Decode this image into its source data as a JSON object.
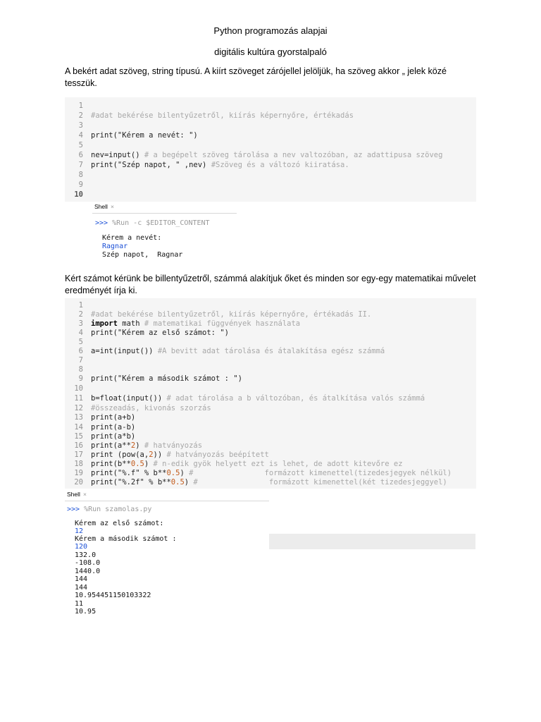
{
  "heading": {
    "title": "Python programozás alapjai",
    "subtitle": "digitális kultúra gyorstalpaló"
  },
  "intro_paragraph": "A bekért adat szöveg, string típusú. A kiírt szöveget zárójellel jelöljük, ha szöveg akkor „ jelek közé tesszük.",
  "second_paragraph": "Kért számot kérünk be billentyűzetről, számmá alakítjuk őket és minden sor egy-egy matematikai művelet eredményét írja ki.",
  "editor1": {
    "line_numbers": [
      "1",
      "2",
      "3",
      "4",
      "5",
      "6",
      "7",
      "8",
      "9",
      "10"
    ],
    "lines": {
      "l2": "#adat bekérése bilentyűzetről, kiírás képernyőre, értékadás",
      "l4": "print(\"Kérem a nevét: \")",
      "l6_code": "nev=input() ",
      "l6_comment": "# a begépelt szöveg tárolása a nev valtozóban, az adattipusa szöveg",
      "l7_code": "print(\"Szép napot, \" ,nev) ",
      "l7_comment": "#Szöveg és a változó kiiratása."
    }
  },
  "shell1": {
    "tab_label": "Shell",
    "tab_close": "×",
    "prompt": ">>>",
    "command": " %Run -c $EDITOR_CONTENT",
    "output": [
      "Kérem a nevét:",
      "Ragnar",
      "Szép napot,  Ragnar"
    ]
  },
  "editor2": {
    "line_numbers": [
      "1",
      "2",
      "3",
      "4",
      "5",
      "6",
      "7",
      "8",
      "9",
      "10",
      "11",
      "12",
      "13",
      "14",
      "15",
      "16",
      "17",
      "18",
      "19",
      "20"
    ],
    "lines": {
      "l2": "#adat bekérése bilentyűzetről, kiírás képernyőre, értékadás II.",
      "l3_kw": "import",
      "l3_code": " math ",
      "l3_comment": "# matematikai függvények használata",
      "l4": "print(\"Kérem az első számot: \")",
      "l6_code": "a=int(input()) ",
      "l6_comment": "#A bevitt adat tárolása és átalakítása egész számmá",
      "l9": "print(\"Kérem a második számot : \")",
      "l11_code": "b=float(input()) ",
      "l11_comment": "# adat tárolása a b változóban, és átalkítása valós számmá",
      "l12": "#összeadás, kivonás szorzás",
      "l13": "print(a+b)",
      "l14": "print(a-b)",
      "l15": "print(a*b)",
      "l16_code": "print(a**",
      "l16_num": "2",
      "l16_code2": ") ",
      "l16_comment": "# hatványozás",
      "l17_code": "print (pow(a,",
      "l17_num": "2",
      "l17_code2": ")) ",
      "l17_comment": "# hatványozás beépített",
      "l18_code": "print(b**",
      "l18_num": "0.5",
      "l18_code2": ") ",
      "l18_comment": "# n-edik gyök helyett ezt is lehet, de adott kitevőre ez",
      "l19_code": "print(\"%.f\" % b**",
      "l19_num": "0.5",
      "l19_code2": ") ",
      "l19_comment": "#                formázott kimenettel(tizedesjegyek nélkül)",
      "l20_code": "print(\"%.2f\" % b**",
      "l20_num": "0.5",
      "l20_code2": ") ",
      "l20_comment": "#                formázott kimenettel(két tizedesjeggyel)"
    }
  },
  "shell2": {
    "tab_label": "Shell",
    "tab_close": "×",
    "prompt": ">>>",
    "command": " %Run szamolas.py",
    "output": [
      {
        "text": "Kérem az első számot:",
        "kind": "out"
      },
      {
        "text": "12",
        "kind": "inp"
      },
      {
        "text": "Kérem a második számot :",
        "kind": "out"
      },
      {
        "text": "120",
        "kind": "inp"
      },
      {
        "text": "132.0",
        "kind": "out"
      },
      {
        "text": "-108.0",
        "kind": "out"
      },
      {
        "text": "1440.0",
        "kind": "out"
      },
      {
        "text": "144",
        "kind": "out"
      },
      {
        "text": "144",
        "kind": "out"
      },
      {
        "text": "10.954451150103322",
        "kind": "out"
      },
      {
        "text": "11",
        "kind": "out"
      },
      {
        "text": "10.95",
        "kind": "out"
      }
    ]
  }
}
